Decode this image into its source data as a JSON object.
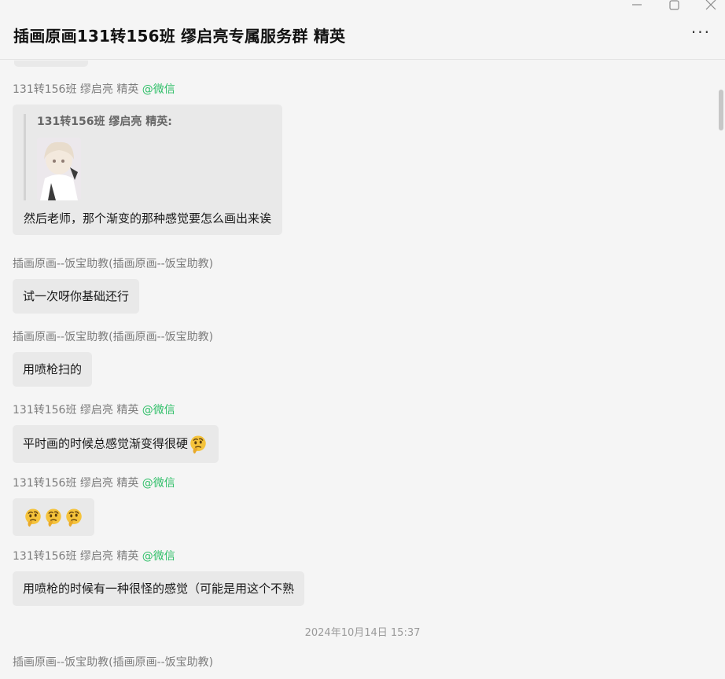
{
  "window": {
    "title": "插画原画131转156班 缪启亮专属服务群 精英",
    "more_label": "···",
    "controls": [
      "minimize-icon",
      "maximize-icon",
      "close-icon"
    ]
  },
  "messages": [
    {
      "sender": "131转156班 缪启亮 精英",
      "sender_suffix": "@微信",
      "quote": {
        "name": "131转156班 缪启亮 精英:",
        "image": "anime-girl-thumbnail"
      },
      "text": "然后老师，那个渐变的那种感觉要怎么画出来诶"
    },
    {
      "sender": "插画原画--饭宝助教(插画原画--饭宝助教)",
      "text": "试一次呀你基础还行"
    },
    {
      "sender": "插画原画--饭宝助教(插画原画--饭宝助教)",
      "text": "用喷枪扫的"
    },
    {
      "sender": "131转156班 缪启亮 精英",
      "sender_suffix": "@微信",
      "text": "平时画的时候总感觉渐变得很硬",
      "emoji": "thinking-face-emoji"
    },
    {
      "sender": "131转156班 缪启亮 精英",
      "sender_suffix": "@微信",
      "emojis": [
        "thinking-face-emoji",
        "thinking-face-emoji",
        "thinking-face-emoji"
      ]
    },
    {
      "sender": "131转156班 缪启亮 精英",
      "sender_suffix": "@微信",
      "text": "用喷枪的时候有一种很怪的感觉（可能是用这个不熟"
    },
    {
      "sender": "插画原画--饭宝助教(插画原画--饭宝助教)"
    }
  ],
  "timestamp": "2024年10月14日 15:37",
  "colors": {
    "background": "#f5f5f5",
    "bubble": "#e9e9e9",
    "wechat_suffix": "#2fbf68",
    "sender": "#7d7d7d"
  }
}
